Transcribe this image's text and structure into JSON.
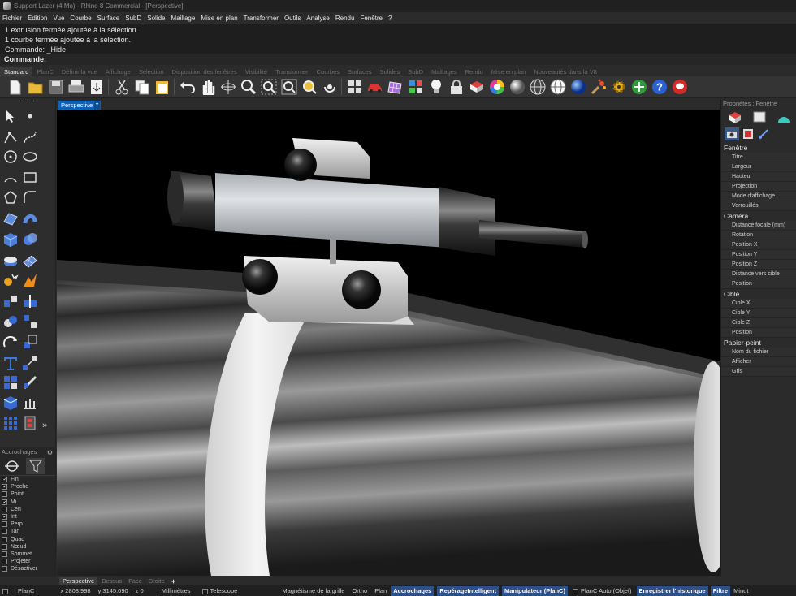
{
  "titlebar": {
    "title": "Support Lazer (4 Mo) - Rhino 8 Commercial - [Perspective]"
  },
  "menu": [
    "Fichier",
    "Édition",
    "Vue",
    "Courbe",
    "Surface",
    "SubD",
    "Solide",
    "Maillage",
    "Mise en plan",
    "Transformer",
    "Outils",
    "Analyse",
    "Rendu",
    "Fenêtre",
    "?"
  ],
  "command_history": [
    "1 extrusion fermée ajoutée à la sélection.",
    "1 courbe fermée ajoutée à la sélection.",
    "Commande: _Hide"
  ],
  "command_prompt": "Commande:",
  "toolbar_tabs": [
    "Standard",
    "PlanC",
    "Définir la vue",
    "Affichage",
    "Sélection",
    "Disposition des fenêtres",
    "Visibilité",
    "Transformer",
    "Courbes",
    "Surfaces",
    "Solides",
    "SubD",
    "Maillages",
    "Rendu",
    "Mise en plan",
    "Nouveautés dans la V8"
  ],
  "toolbar_icons": [
    "new-icon",
    "open-icon",
    "save-icon",
    "print-icon",
    "import-icon",
    "cut-icon",
    "copy-icon",
    "paste-icon",
    "undo-icon",
    "pan-icon",
    "rotate-view-icon",
    "zoom-icon",
    "zoom-window-icon",
    "zoom-extents-icon",
    "zoom-selected-icon",
    "rotate-icon",
    "four-views-icon",
    "car-icon",
    "grid-icon",
    "layers-icon",
    "light-icon",
    "lock-icon",
    "material-icon",
    "color-wheel-icon",
    "sphere-icon",
    "wire-sphere-icon",
    "render-sphere-icon",
    "spray-icon",
    "gear-icon",
    "gumball-icon",
    "help-icon",
    "chat-icon"
  ],
  "viewport": {
    "tab_label": "Perspective",
    "tabs": [
      "Perspective",
      "Dessus",
      "Face",
      "Droite"
    ],
    "add_tab": "+"
  },
  "snaps": {
    "title": "Accrochages",
    "items": [
      {
        "label": "Fin",
        "checked": true
      },
      {
        "label": "Proche",
        "checked": true
      },
      {
        "label": "Point",
        "checked": false
      },
      {
        "label": "Mi",
        "checked": true
      },
      {
        "label": "Cen",
        "checked": false
      },
      {
        "label": "Int",
        "checked": true
      },
      {
        "label": "Perp",
        "checked": false
      },
      {
        "label": "Tan",
        "checked": false
      },
      {
        "label": "Quad",
        "checked": false
      },
      {
        "label": "Nœud",
        "checked": false
      },
      {
        "label": "Sommet",
        "checked": false
      },
      {
        "label": "Projeter",
        "checked": false
      },
      {
        "label": "Désactiver",
        "checked": false
      }
    ]
  },
  "properties": {
    "title": "Propriétés : Fenêtre",
    "sections": [
      {
        "name": "Fenêtre",
        "items": [
          "Titre",
          "Largeur",
          "Hauteur",
          "Projection",
          "Mode d'affichage",
          "Verrouillés"
        ]
      },
      {
        "name": "Caméra",
        "items": [
          "Distance focale (mm)",
          "Rotation",
          "Position X",
          "Position Y",
          "Position Z",
          "Distance vers cible",
          "Position"
        ]
      },
      {
        "name": "Cible",
        "items": [
          "Cible X",
          "Cible Y",
          "Cible Z",
          "Position"
        ]
      },
      {
        "name": "Papier-peint",
        "items": [
          "Nom du fichier",
          "Afficher",
          "Gris"
        ]
      }
    ]
  },
  "status": {
    "cplane": "PlanC",
    "x": "x 2808.998",
    "y": "y 3145.090",
    "z": "z 0",
    "units": "Millimètres",
    "layer": "Telescope",
    "grid_snap": "Magnétisme de la grille",
    "ortho": "Ortho",
    "plan": "Plan",
    "osnap": "Accrochages",
    "smarttrack": "RepérageIntelligent",
    "gumball": "Manipulateur (PlanC)",
    "auto_cplane": "PlanC Auto (Objet)",
    "history": "Enregistrer l'historique",
    "filter": "Filtre",
    "minutes": "Minut"
  },
  "colors": {
    "accent": "#0f5fb2",
    "status_on": "#2d4f8a",
    "background": "#2b2b2b"
  }
}
